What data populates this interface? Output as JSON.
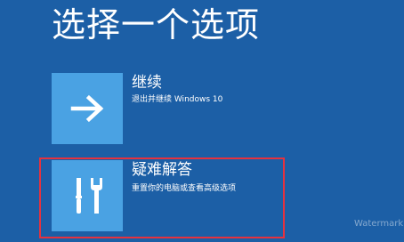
{
  "page": {
    "title": "选择一个选项"
  },
  "options": [
    {
      "label": "继续",
      "description": "退出并继续 Windows 10",
      "icon": "arrow-right-icon"
    },
    {
      "label": "疑难解答",
      "description": "重置你的电脑或查看高级选项",
      "icon": "tools-icon"
    }
  ],
  "colors": {
    "background": "#1c5fa6",
    "tile": "#4aa2e3",
    "highlight": "#e5323f",
    "text": "#ffffff"
  },
  "watermark": "Watermark"
}
